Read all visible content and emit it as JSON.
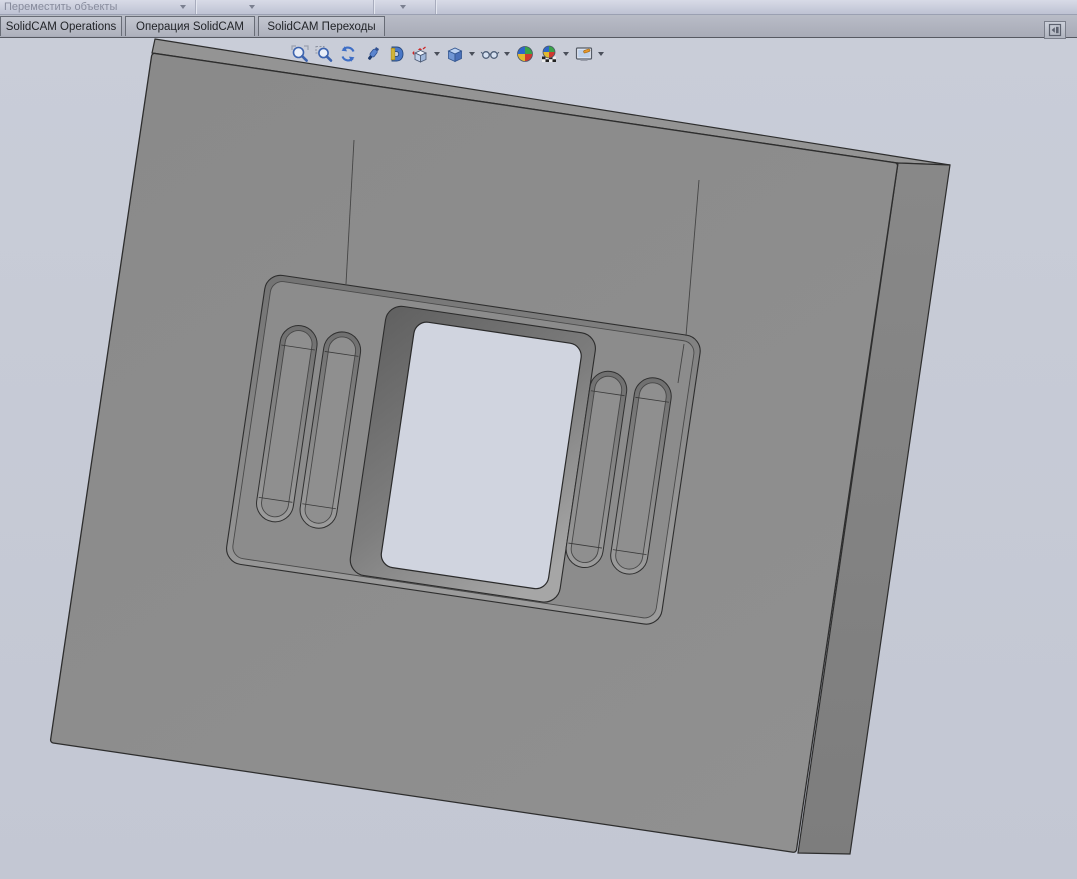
{
  "toolbar_row": {
    "move_objects_label": "Переместить объекты",
    "combo_arrow_count": 3
  },
  "tabs": [
    {
      "label": "SolidCAM Operations"
    },
    {
      "label": "Операция  SolidCAM"
    },
    {
      "label": "SolidCAM Переходы"
    }
  ],
  "heads_up_toolbar": {
    "icons": [
      {
        "name": "zoom-to-fit",
        "has_dropdown": false
      },
      {
        "name": "zoom-to-area",
        "has_dropdown": false
      },
      {
        "name": "previous-view",
        "has_dropdown": false
      },
      {
        "name": "section-view",
        "has_dropdown": false
      },
      {
        "name": "magnet",
        "has_dropdown": false
      },
      {
        "name": "view-orientation",
        "has_dropdown": true
      },
      {
        "name": "display-style",
        "has_dropdown": true
      },
      {
        "name": "hide-show-items",
        "has_dropdown": true
      },
      {
        "name": "edit-appearance",
        "has_dropdown": false
      },
      {
        "name": "apply-scene",
        "has_dropdown": true
      },
      {
        "name": "view-settings",
        "has_dropdown": true
      }
    ]
  },
  "collapse_button": {
    "icon": "collapse-panel-icon"
  },
  "viewport": {
    "background_color": "#c6cad5",
    "part_face_color": "#8c8c8c",
    "part_side_color": "#838383",
    "part_top_sliver_color": "#949494",
    "edge_color": "#2d2d2d",
    "hole_backdrop_color": "#d0d4df"
  }
}
